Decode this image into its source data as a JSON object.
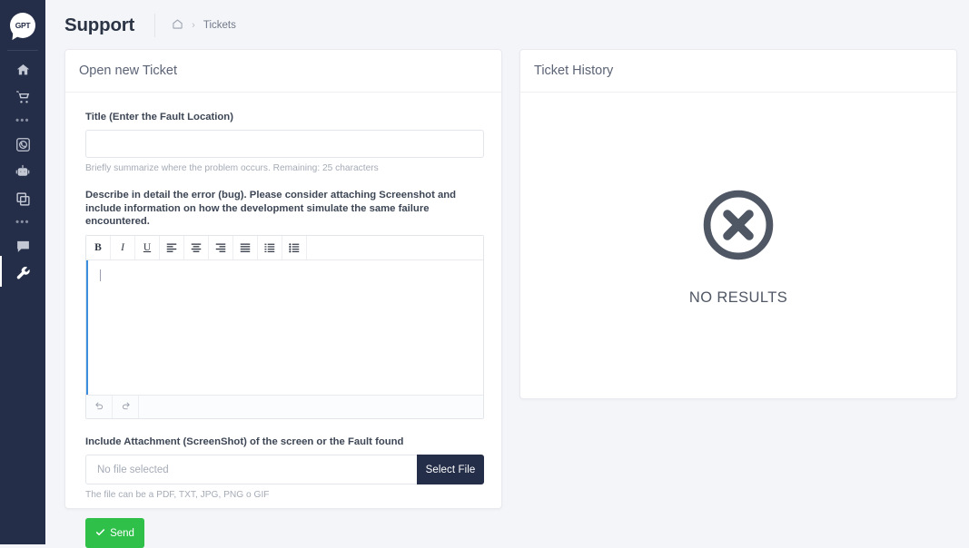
{
  "sidebar": {
    "logo": {
      "name": "gpt-logo",
      "text": "GPT"
    },
    "items": [
      {
        "icon": "home-icon",
        "label": "Home",
        "active": false
      },
      {
        "icon": "cart-icon",
        "label": "Shop",
        "active": false
      },
      {
        "icon": "ellipsis-icon",
        "label": "...",
        "active": false
      },
      {
        "icon": "whatsapp-icon",
        "label": "WhatsApp",
        "active": false
      },
      {
        "icon": "robot-icon",
        "label": "Bots",
        "active": false
      },
      {
        "icon": "layers-icon",
        "label": "Pages",
        "active": false
      },
      {
        "icon": "ellipsis-icon",
        "label": "...",
        "active": false
      },
      {
        "icon": "chat-icon",
        "label": "Chat",
        "active": false
      },
      {
        "icon": "wrench-icon",
        "label": "Support",
        "active": true
      }
    ]
  },
  "header": {
    "title": "Support",
    "breadcrumb": {
      "home_icon": "home-icon",
      "separator": "›",
      "current": "Tickets"
    }
  },
  "new_ticket": {
    "card_title": "Open new Ticket",
    "title_field": {
      "label": "Title (Enter the Fault Location)",
      "value": "",
      "placeholder": "",
      "helper": "Briefly summarize where the problem occurs. Remaining: 25 characters"
    },
    "description_field": {
      "label": "Describe in detail the error (bug). Please consider attaching Screenshot and include information on how the development simulate the same failure encountered.",
      "value": "",
      "toolbar": [
        {
          "name": "bold-button",
          "glyph": "B"
        },
        {
          "name": "italic-button",
          "glyph": "I"
        },
        {
          "name": "underline-button",
          "glyph": "U"
        },
        {
          "name": "align-left-button",
          "glyph": "align-left-icon"
        },
        {
          "name": "align-center-button",
          "glyph": "align-center-icon"
        },
        {
          "name": "align-right-button",
          "glyph": "align-right-icon"
        },
        {
          "name": "align-justify-button",
          "glyph": "align-justify-icon"
        },
        {
          "name": "ordered-list-button",
          "glyph": "ordered-list-icon"
        },
        {
          "name": "bullet-list-button",
          "glyph": "bullet-list-icon"
        }
      ],
      "footer": [
        {
          "name": "undo-button",
          "glyph": "undo-icon"
        },
        {
          "name": "redo-button",
          "glyph": "redo-icon"
        }
      ]
    },
    "attachment_field": {
      "label": "Include Attachment (ScreenShot) of the screen or the Fault found",
      "file_name": "No file selected",
      "button_label": "Select File",
      "helper": "The file can be a PDF, TXT, JPG, PNG o GIF"
    },
    "send_button": {
      "label": "Send",
      "icon": "check-icon",
      "color": "#2fc04a"
    }
  },
  "ticket_history": {
    "card_title": "Ticket History",
    "empty_state": {
      "icon": "circle-x-icon",
      "text": "NO RESULTS"
    }
  },
  "theme": {
    "sidebar_bg": "#242e49",
    "page_bg": "#f4f5f8",
    "accent_blue": "#3c8dde",
    "success_green": "#2fc04a",
    "dark_button": "#242e49"
  }
}
